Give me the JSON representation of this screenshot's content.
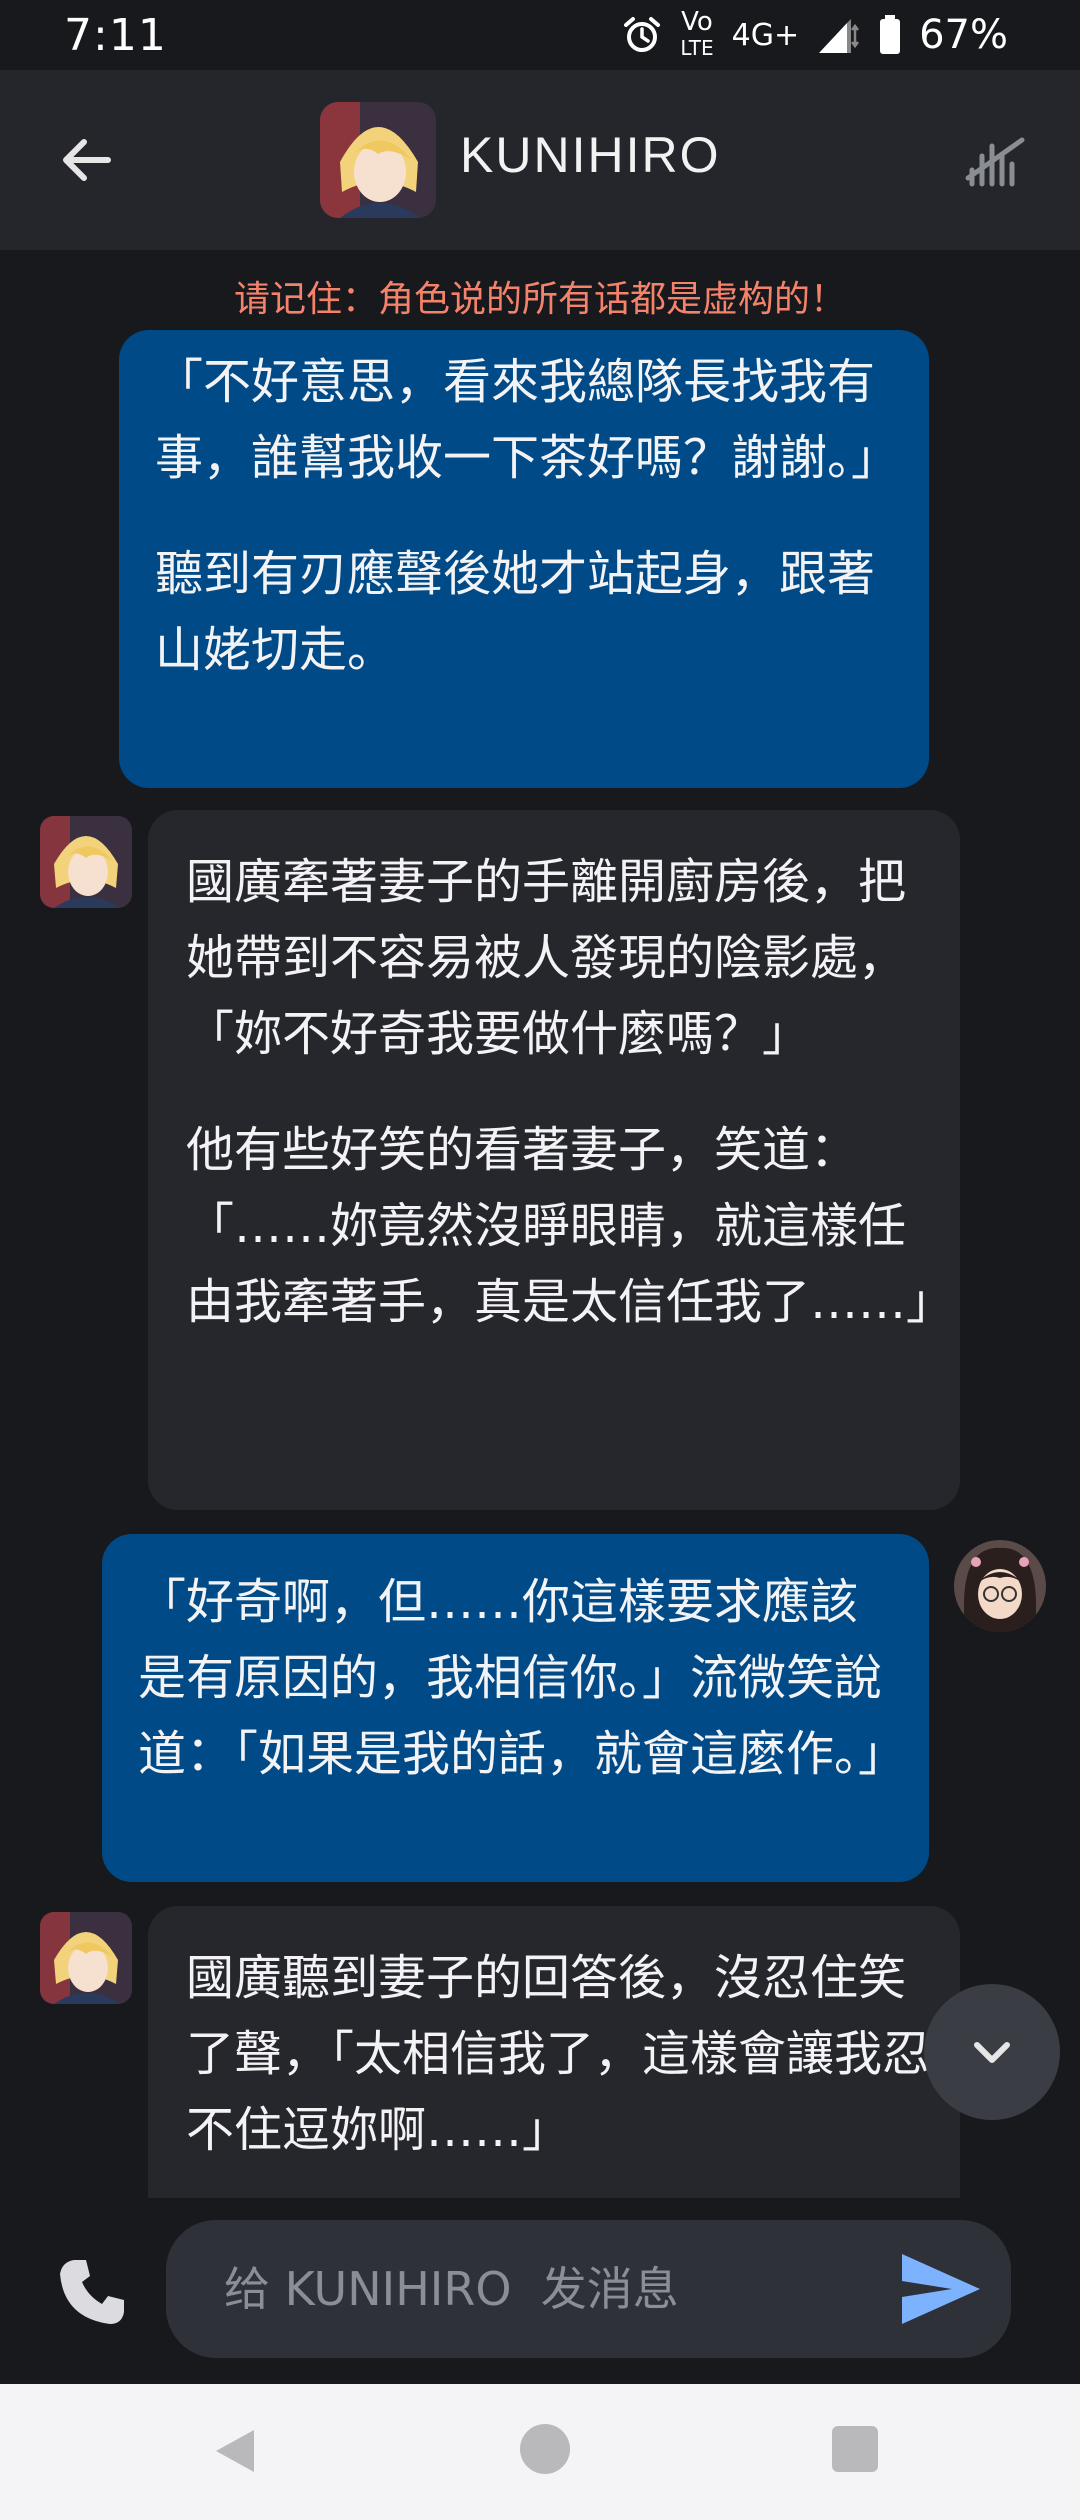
{
  "status_bar": {
    "time": "7:11",
    "volte_top": "Vo",
    "volte_bottom": "LTE",
    "network": "4G+",
    "battery": "67%"
  },
  "header": {
    "title": "KUNIHIRO"
  },
  "notice": "请记住：角色说的所有话都是虚构的！",
  "messages": [
    {
      "role": "user",
      "paragraphs": [
        "「不好意思，看來我總隊長找我有事，誰幫我收一下茶好嗎？謝謝。」",
        "聽到有刃應聲後她才站起身，跟著山姥切走。"
      ]
    },
    {
      "role": "character",
      "paragraphs": [
        "國廣牽著妻子的手離開廚房後，把她帶到不容易被人發現的陰影處，「妳不好奇我要做什麼嗎？」",
        "他有些好笑的看著妻子，笑道：「……妳竟然沒睜眼睛，就這樣任由我牽著手，真是太信任我了……」"
      ]
    },
    {
      "role": "user",
      "paragraphs": [
        "「好奇啊，但……你這樣要求應該是有原因的，我相信你。」流微笑說道：「如果是我的話，就會這麼作。」"
      ]
    },
    {
      "role": "character",
      "paragraphs": [
        "國廣聽到妻子的回答後，沒忍住笑了聲，「太相信我了，這樣會讓我忍不住逗妳啊……」"
      ]
    }
  ],
  "composer": {
    "placeholder": "给 KUNIHIRO  发消息"
  },
  "colors": {
    "user_bubble": "#004b87",
    "character_bubble": "#26272c",
    "notice": "#f5836b",
    "send": "#7db2ff"
  }
}
